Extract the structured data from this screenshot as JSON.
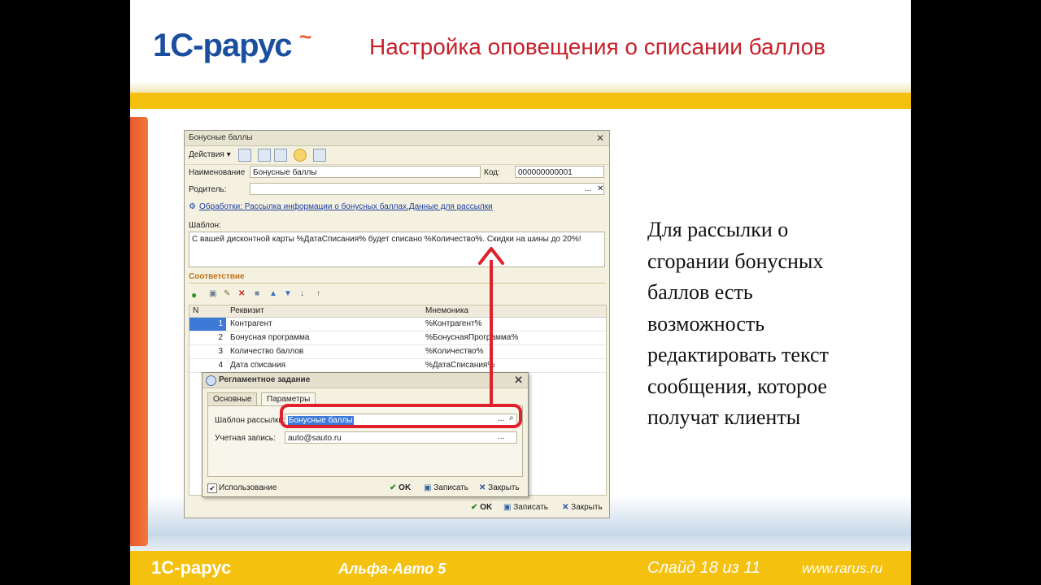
{
  "header": {
    "logo": "1С-рарус",
    "title": "Настройка оповещения о списании баллов"
  },
  "window": {
    "title": "Бонусные баллы",
    "toolbar": {
      "actions_label": "Действия ▾"
    },
    "name_label": "Наименование",
    "name_value": "Бонусные баллы",
    "code_label": "Код:",
    "code_value": "000000000001",
    "parent_label": "Родитель:",
    "parent_value": "",
    "processing_link": "Обработки: Рассылка информации о бонусных баллах.Данные для рассылки",
    "template_label": "Шаблон:",
    "template_value": "С вашей дисконтной карты %ДатаСписания% будет списано %Количество%. Скидки на шины до 20%!",
    "mapping_section": "Соответствие",
    "grid": {
      "columns": [
        "N",
        "Реквизит",
        "Мнемоника"
      ],
      "rows": [
        {
          "n": "1",
          "attr": "Контрагент",
          "mnemo": "%Контрагент%"
        },
        {
          "n": "2",
          "attr": "Бонусная программа",
          "mnemo": "%БонуснаяПрограмма%"
        },
        {
          "n": "3",
          "attr": "Количество баллов",
          "mnemo": "%Количество%"
        },
        {
          "n": "4",
          "attr": "Дата списания",
          "mnemo": "%ДатаСписания%"
        }
      ]
    },
    "buttons": {
      "ok": "OK",
      "save": "Записать",
      "close": "Закрыть"
    }
  },
  "dialog": {
    "title": "Регламентное задание",
    "tabs": [
      "Основные",
      "Параметры"
    ],
    "template_label": "Шаблон рассылки:",
    "template_value": "Бонусные баллы",
    "account_label": "Учетная запись:",
    "account_value": "auto@sauto.ru",
    "usage_label": "Использование",
    "buttons": {
      "ok": "OK",
      "save": "Записать",
      "close": "Закрыть"
    }
  },
  "description": [
    "Для рассылки о",
    "сгорании бонусных",
    "баллов есть",
    "возможность",
    "редактировать текст",
    "сообщения, которое",
    "получат клиенты"
  ],
  "footer": {
    "logo": "1С-рарус",
    "product": "Альфа-Авто 5",
    "slide": "Слайд 18 из 11",
    "url": "www.rarus.ru"
  },
  "colors": {
    "brand_blue": "#1a4fa0",
    "title_red": "#c8202a",
    "band_yellow": "#f5c10f",
    "highlight_red": "#e0202a"
  }
}
